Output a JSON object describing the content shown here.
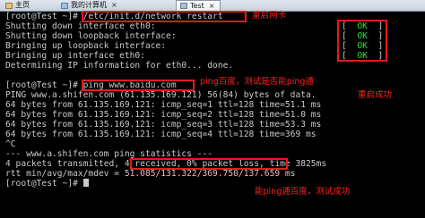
{
  "tabs": [
    {
      "label": "主页",
      "icon": "home-icon"
    },
    {
      "label": "我的计算机",
      "icon": "computer-icon"
    },
    {
      "label": "Test",
      "icon": "vm-icon",
      "active": true
    }
  ],
  "terminal": {
    "lines": [
      "[root@Test ~]# /etc/init.d/network restart",
      "Shutting down interface eth0:",
      "Shutting down loopback interface:",
      "Bringing up loopback interface:",
      "Bringing up interface eth0:",
      "Determining IP information for eth0... done.",
      "",
      "[root@Test ~]# ping www.baidu.com",
      "PING www.a.shifen.com (61.135.169.121) 56(84) bytes of data.",
      "64 bytes from 61.135.169.121: icmp_seq=1 ttl=128 time=51.1 ms",
      "64 bytes from 61.135.169.121: icmp_seq=2 ttl=128 time=51.0 ms",
      "64 bytes from 61.135.169.121: icmp_seq=3 ttl=128 time=53.3 ms",
      "64 bytes from 61.135.169.121: icmp_seq=4 ttl=128 time=369 ms",
      "^C",
      "--- www.a.shifen.com ping statistics ---",
      "4 packets transmitted, 4 received, 0% packet loss, time 3825ms",
      "rtt min/avg/max/mdev = 51.085/131.322/369.750/137.659 ms",
      "[root@Test ~]# "
    ],
    "status_ok": [
      "[  OK  ]",
      "[  OK  ]",
      "[  OK  ]",
      "[  OK  ]"
    ],
    "ok_word": "OK"
  },
  "annotations": {
    "restart_nic": "重启网卡",
    "ping_baidu": "ping百度，测试是否能ping通",
    "restart_success": "重启成功",
    "ping_success": "能ping通百度，测试成功"
  },
  "colors": {
    "terminal_bg": "#000000",
    "terminal_text": "#c9c9c9",
    "ok_green": "#2fe12f",
    "annotation_red": "#ff2020"
  }
}
